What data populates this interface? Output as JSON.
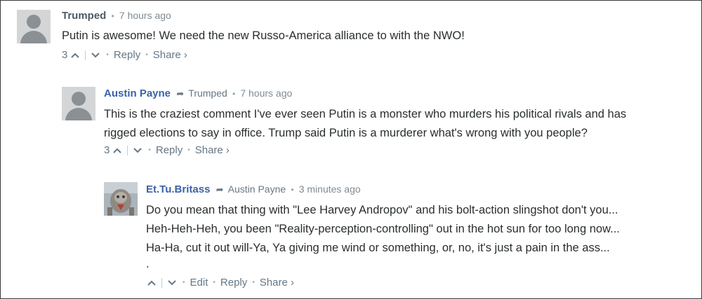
{
  "comments": [
    {
      "author": "Trumped",
      "reply_to": "",
      "time": "7 hours ago",
      "lines": [
        "Putin is awesome! We need the new Russo-America alliance to with the NWO!"
      ],
      "votes": "3",
      "actions": {
        "reply": "Reply",
        "share": "Share ›"
      }
    },
    {
      "author": "Austin Payne",
      "reply_to": "Trumped",
      "time": "7 hours ago",
      "lines": [
        "This is the craziest comment I've ever seen Putin is a monster who murders his political rivals and has",
        "rigged elections to say in office. Trump said Putin is a murderer what's wrong with you people?"
      ],
      "votes": "3",
      "actions": {
        "reply": "Reply",
        "share": "Share ›"
      }
    },
    {
      "author": "Et.Tu.Britass",
      "reply_to": "Austin Payne",
      "time": "3 minutes ago",
      "lines": [
        "Do you mean that thing with \"Lee Harvey Andropov\" and his bolt-action slingshot don't you...",
        "Heh-Heh-Heh, you been \"Reality-perception-controlling\" out in the hot sun for too long now...",
        "Ha-Ha, cut it out will-Ya, Ya giving me wind or something, or, no, it's just a pain in the ass...",
        "."
      ],
      "votes": "",
      "actions": {
        "edit": "Edit",
        "reply": "Reply",
        "share": "Share ›"
      }
    }
  ],
  "icons": {
    "upvote": "chevron-up-icon",
    "downvote": "chevron-down-icon",
    "reply_arrow": "reply-arrow-icon"
  },
  "colors": {
    "author_primary": "#3a63a8",
    "author_top": "#4e5c66",
    "meta": "#657786",
    "avatar_placeholder": "#d3d5d6"
  }
}
